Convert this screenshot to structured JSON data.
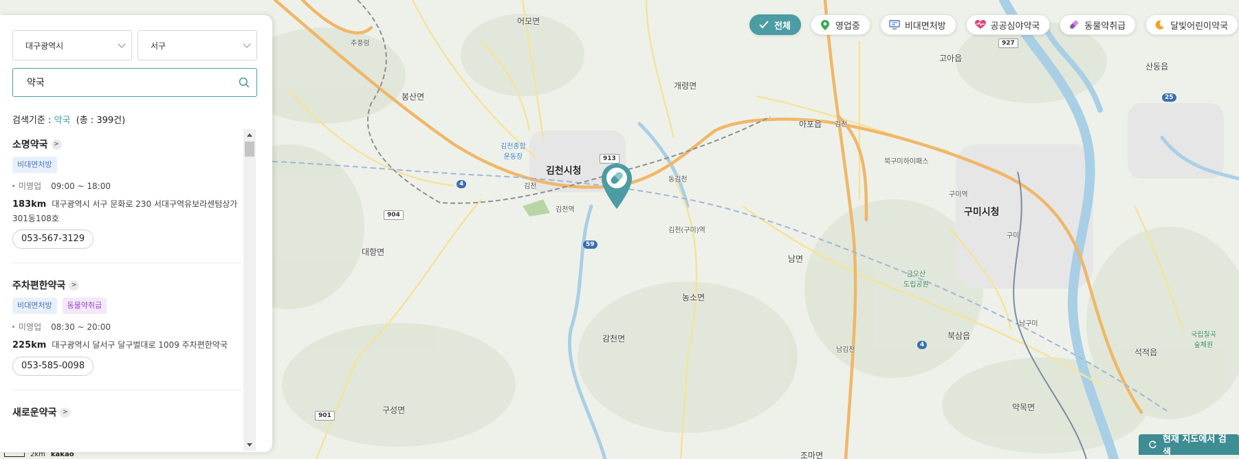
{
  "region": {
    "city": "대구광역시",
    "district": "서구"
  },
  "search": {
    "value": "약국",
    "placeholder": ""
  },
  "criteria": {
    "label": "검색기준 :",
    "keyword": "약국",
    "total": "(총 : 399건)"
  },
  "results": [
    {
      "name": "소명약국",
      "tags": [
        "비대면처방"
      ],
      "status": "미영업",
      "hours": "09:00 ~ 18:00",
      "distance": "183km",
      "address": "대구광역시 서구 문화로 230 서대구역유보라센텀상가 301동108호",
      "phone": "053-567-3129"
    },
    {
      "name": "주차편한약국",
      "tags": [
        "비대면처방",
        "동물약취급"
      ],
      "status": "미영업",
      "hours": "08:30 ~ 20:00",
      "distance": "225km",
      "address": "대구광역시 달서구 달구벌대로 1009 주차편한약국",
      "phone": "053-585-0098"
    },
    {
      "name": "새로운약국"
    }
  ],
  "filters": [
    "전체",
    "영업중",
    "비대면처방",
    "공공심야약국",
    "동물약취급",
    "달빛어린이약국"
  ],
  "map": {
    "search_button": "현재 지도에서 검색",
    "scale": "2km",
    "brand": "kakao",
    "places": {
      "gimcheon_city": "김천시청",
      "gumi_city": "구미시청",
      "eomyeon": "어모면",
      "bongsan": "봉산면",
      "gaeryeong": "개령면",
      "apo": "아포읍",
      "gimcheon": "김천",
      "goa": "고아읍",
      "sandong": "산동읍",
      "daehang": "대항면",
      "nam": "남면",
      "nongso": "농소면",
      "gamcheon": "감천면",
      "guseong": "구성면",
      "josan": "조마면",
      "buksam": "북삼읍",
      "yakmok": "약목면",
      "seokjeok": "석적읍",
      "gimcheon_st": "김천역",
      "gimcheon_gumi_st": "김천(구미)역",
      "gumi_st": "구미역",
      "dong_gimcheon": "동김천",
      "gimcheon_ic": "김천",
      "bukgumi": "북구미하이패스",
      "gumi_ic": "구미",
      "namgumi": "남구미",
      "namgimcheon": "남김천",
      "gimcheon_sports": "김천종합\n운동장",
      "geumosan": "금오산\n도립공원",
      "forest": "국립칠곡\n숲체원",
      "chupungnyeong": "추풍령"
    },
    "roads": [
      "4",
      "904",
      "59",
      "913",
      "901",
      "927",
      "25",
      "4"
    ]
  },
  "colors": {
    "accent": "#4b9ca3",
    "panel_bg": "#ffffff",
    "tag_blue": "#4a74c3",
    "tag_purple": "#9a49c1"
  }
}
